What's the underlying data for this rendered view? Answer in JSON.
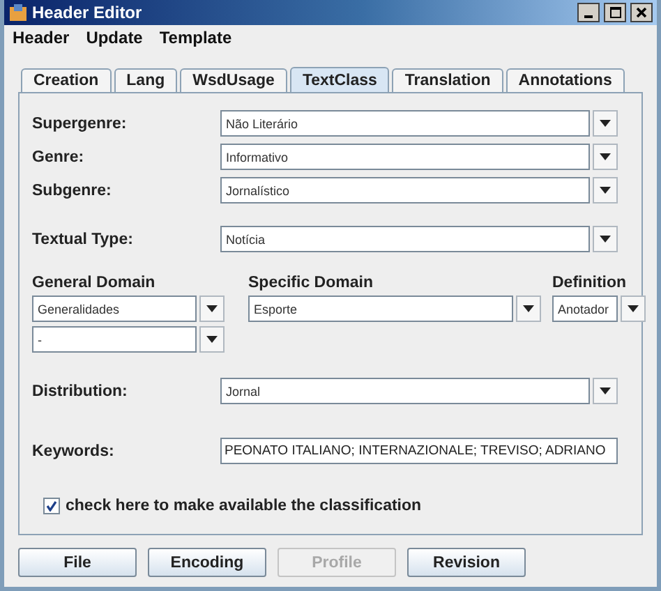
{
  "window": {
    "title": "Header Editor"
  },
  "menu": [
    "Header",
    "Update",
    "Template"
  ],
  "tabs": [
    {
      "label": "Creation",
      "selected": false
    },
    {
      "label": "Lang",
      "selected": false
    },
    {
      "label": "WsdUsage",
      "selected": false
    },
    {
      "label": "TextClass",
      "selected": true
    },
    {
      "label": "Translation",
      "selected": false
    },
    {
      "label": "Annotations",
      "selected": false
    }
  ],
  "genre_fields": [
    {
      "label": "Supergenre:",
      "value": "Não Literário"
    },
    {
      "label": "Genre:",
      "value": "Informativo"
    },
    {
      "label": "Subgenre:",
      "value": "Jornalístico"
    }
  ],
  "textual_type": {
    "label": "Textual Type:",
    "value": "Notícia"
  },
  "domains": [
    {
      "label": "General Domain",
      "values": [
        "Generalidades",
        "-"
      ]
    },
    {
      "label": "Specific Domain",
      "values": [
        "Esporte"
      ]
    },
    {
      "label": "Definition",
      "values": [
        "Anotador"
      ]
    }
  ],
  "distribution": {
    "label": "Distribution:",
    "value": "Jornal"
  },
  "keywords": {
    "label": "Keywords:",
    "value": "PEONATO ITALIANO; INTERNAZIONALE; TREVISO; ADRIANO"
  },
  "classification": {
    "label": "check here to make available the classification",
    "checked": true
  },
  "buttons": [
    {
      "label": "File",
      "disabled": false
    },
    {
      "label": "Encoding",
      "disabled": false
    },
    {
      "label": "Profile",
      "disabled": true
    },
    {
      "label": "Revision",
      "disabled": false
    }
  ]
}
